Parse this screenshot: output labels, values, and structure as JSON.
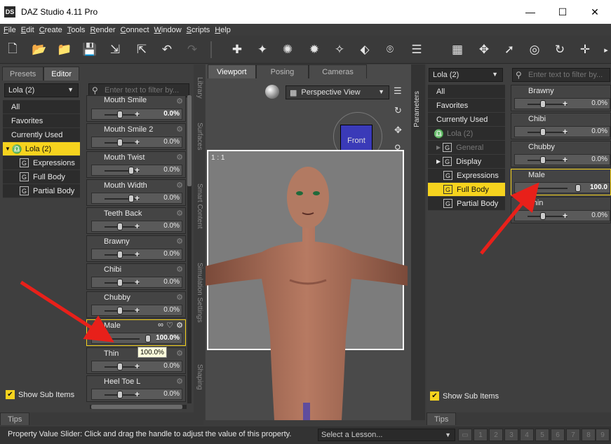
{
  "window": {
    "title": "DAZ Studio 4.11 Pro",
    "logo": "DS",
    "min": "—",
    "max": "☐",
    "close": "✕"
  },
  "menu": [
    "File",
    "Edit",
    "Create",
    "Tools",
    "Render",
    "Connect",
    "Window",
    "Scripts",
    "Help"
  ],
  "left_panel": {
    "tabs": [
      "Presets",
      "Editor"
    ],
    "active_tab": "Editor",
    "figure_select": "Lola (2)",
    "filter_placeholder": "Enter text to filter by...",
    "categories": [
      {
        "label": "All"
      },
      {
        "label": "Favorites"
      },
      {
        "label": "Currently Used"
      },
      {
        "label": "Lola (2)",
        "selected": true
      },
      {
        "label": "Expressions"
      },
      {
        "label": "Full Body"
      },
      {
        "label": "Partial Body"
      }
    ],
    "properties": [
      {
        "name": "Mouth Smile",
        "value": "0.0%"
      },
      {
        "name": "Mouth Smile 2",
        "value": "0.0%"
      },
      {
        "name": "Mouth Twist",
        "value": "0.0%"
      },
      {
        "name": "Mouth Width",
        "value": "0.0%"
      },
      {
        "name": "Teeth Back",
        "value": "0.0%"
      },
      {
        "name": "Brawny",
        "value": "0.0%"
      },
      {
        "name": "Chibi",
        "value": "0.0%"
      },
      {
        "name": "Chubby",
        "value": "0.0%"
      },
      {
        "name": "Male",
        "value": "100.0%"
      },
      {
        "name": "Thin",
        "value": "0.0%"
      },
      {
        "name": "Heel Toe L",
        "value": "0.0%"
      }
    ],
    "show_sub_items": "Show Sub Items",
    "tooltip": "100.0%"
  },
  "side_tabs_left": [
    "Library",
    "Surfaces",
    "Smart Content",
    "Simulation Settings",
    "Shaping"
  ],
  "viewport": {
    "tabs": [
      "Viewport",
      "Posing",
      "Cameras"
    ],
    "active_tab": "Viewport",
    "view_select": "Perspective View",
    "ratio_label": "1 : 1",
    "cube_label": "Front"
  },
  "right_panel": {
    "side_tab": "Parameters",
    "figure_select": "Lola (2)",
    "filter_placeholder": "Enter text to filter by...",
    "categories": [
      {
        "label": "All"
      },
      {
        "label": "Favorites"
      },
      {
        "label": "Currently Used"
      },
      {
        "label": "Lola (2)"
      },
      {
        "label": "General"
      },
      {
        "label": "Display"
      },
      {
        "label": "Expressions"
      },
      {
        "label": "Full Body",
        "selected": true
      },
      {
        "label": "Partial Body"
      }
    ],
    "properties": [
      {
        "name": "Brawny",
        "value": "0.0%"
      },
      {
        "name": "Chibi",
        "value": "0.0%"
      },
      {
        "name": "Chubby",
        "value": "0.0%"
      },
      {
        "name": "Male",
        "value": "100.0"
      },
      {
        "name": "Thin",
        "value": "0.0%"
      }
    ],
    "show_sub_items": "Show Sub Items"
  },
  "bottom": {
    "tips_left": "Tips",
    "tips_right": "Tips",
    "status": "Property Value Slider: Click and drag the handle to adjust the value of this property.",
    "lesson_select": "Select a Lesson...",
    "steps": [
      "1",
      "2",
      "3",
      "4",
      "5",
      "6",
      "7",
      "8",
      "9"
    ]
  },
  "colors": {
    "selection": "#f6d31e",
    "panel": "#3f3f3f",
    "annotation_arrow": "#e8201a"
  }
}
